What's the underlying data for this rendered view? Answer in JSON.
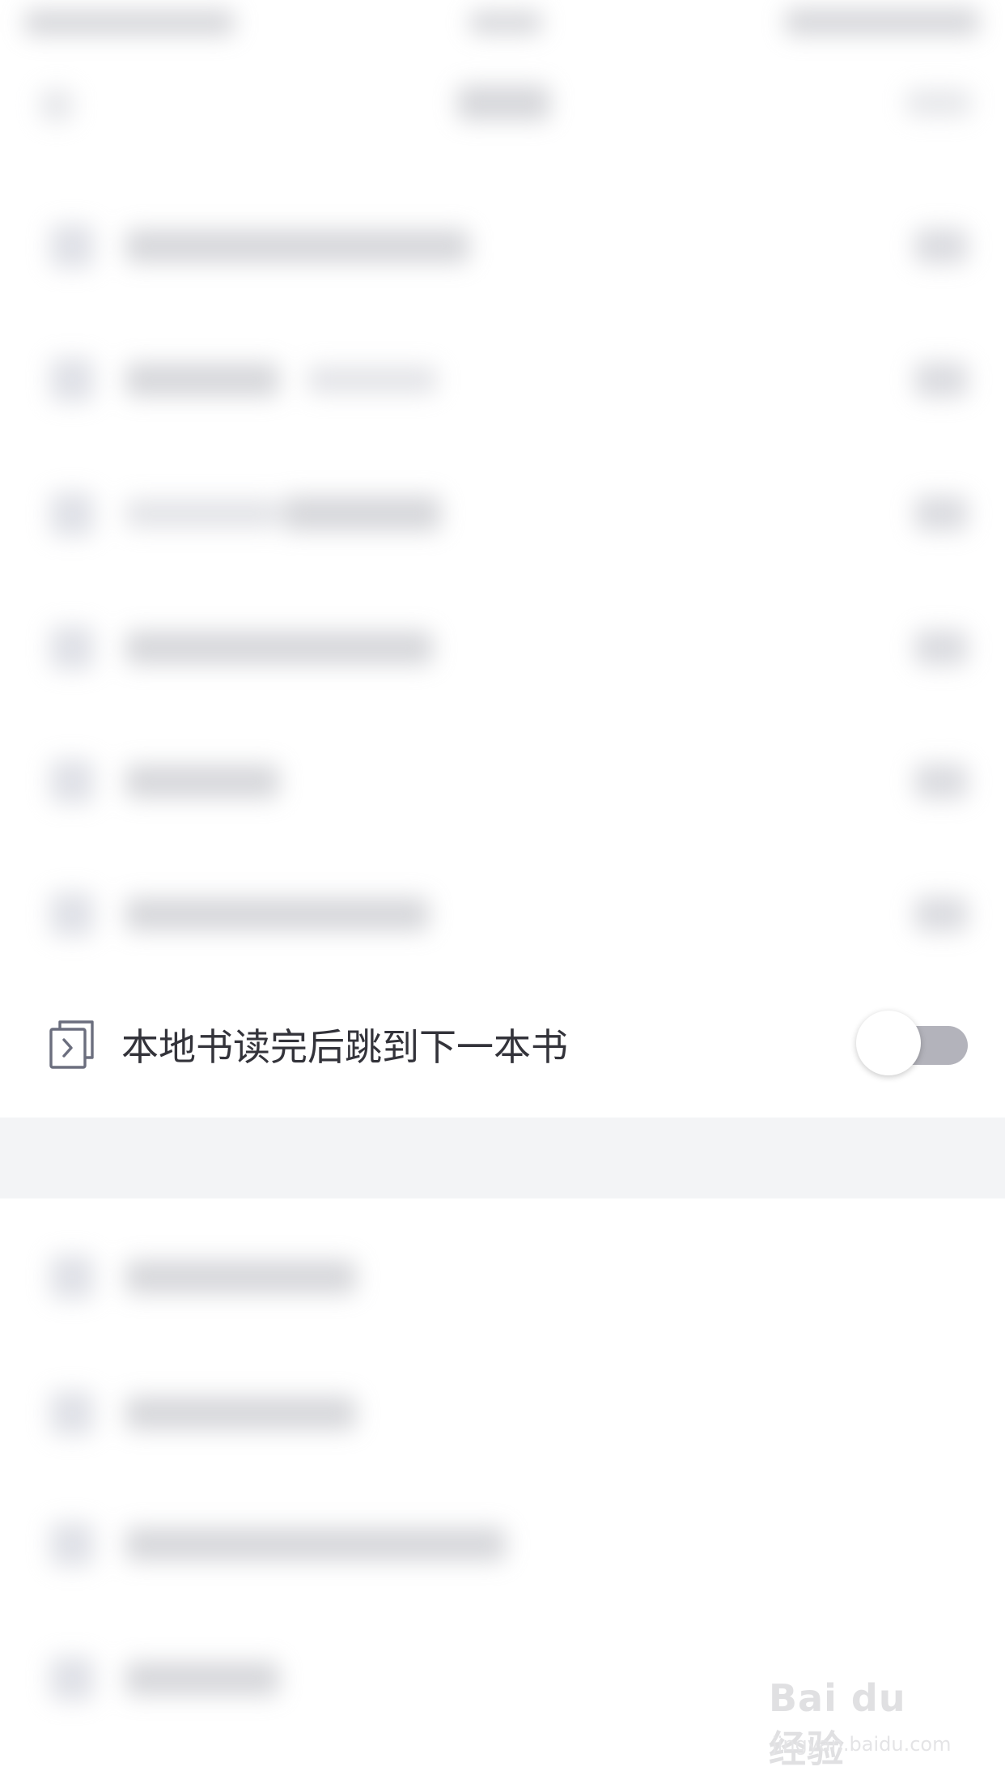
{
  "setting_row": {
    "label": "本地书读完后跳到下一本书",
    "toggle_on": false,
    "colors": {
      "label": "#33333a",
      "icon_stroke": "#6b6e7e",
      "toggle_track_off": "#b3b3bb",
      "toggle_knob": "#ffffff"
    },
    "icon": "next-book-icon"
  },
  "watermark": {
    "logo_text": "Bai du 经验",
    "url_text": "jingyan.baidu.com"
  }
}
